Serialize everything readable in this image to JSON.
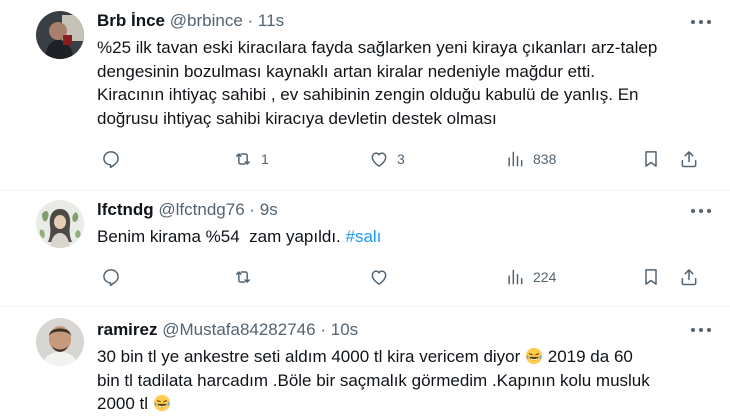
{
  "tweets": [
    {
      "name": "Brb İnce",
      "handle": "@brbince",
      "separator": "·",
      "time": "11s",
      "lines": [
        "%25 ilk tavan eski kiracılara fayda sağlarken yeni kiraya çıkanları arz-talep",
        "dengesinin bozulması kaynaklı artan kiralar nedeniyle mağdur etti.",
        "Kiracının ihtiyaç sahibi , ev sahibinin zengin olduğu kabulü de yanlış. En",
        "doğrusu ihtiyaç sahibi kiracıya devletin destek olması"
      ],
      "reply_count": "",
      "retweet_count": "1",
      "like_count": "3",
      "view_count": "838"
    },
    {
      "name": "lfctndg",
      "handle": "@lfctndg76",
      "separator": "·",
      "time": "9s",
      "text": "Benim kirama %54  zam yapıldı.",
      "hashtag": "#salı",
      "reply_count": "",
      "retweet_count": "",
      "like_count": "",
      "view_count": "224"
    },
    {
      "name": "ramirez",
      "handle": "@Mustafa84282746",
      "separator": "·",
      "time": "10s",
      "line1": "30 bin tl ye ankestre seti aldım 4000 tl kira vericem diyor",
      "line1_tail": " 2019 da 60",
      "line2": "bin tl tadilata harcadım .Böle bir saçmalık görmedim .Kapının kolu musluk",
      "line3": "2000 tl",
      "emoji": "face-with-tears-of-joy"
    }
  ],
  "colors": {
    "text": "#0f1419",
    "muted": "#536471",
    "link": "#1d9bf0",
    "divider": "#eff3f4"
  }
}
